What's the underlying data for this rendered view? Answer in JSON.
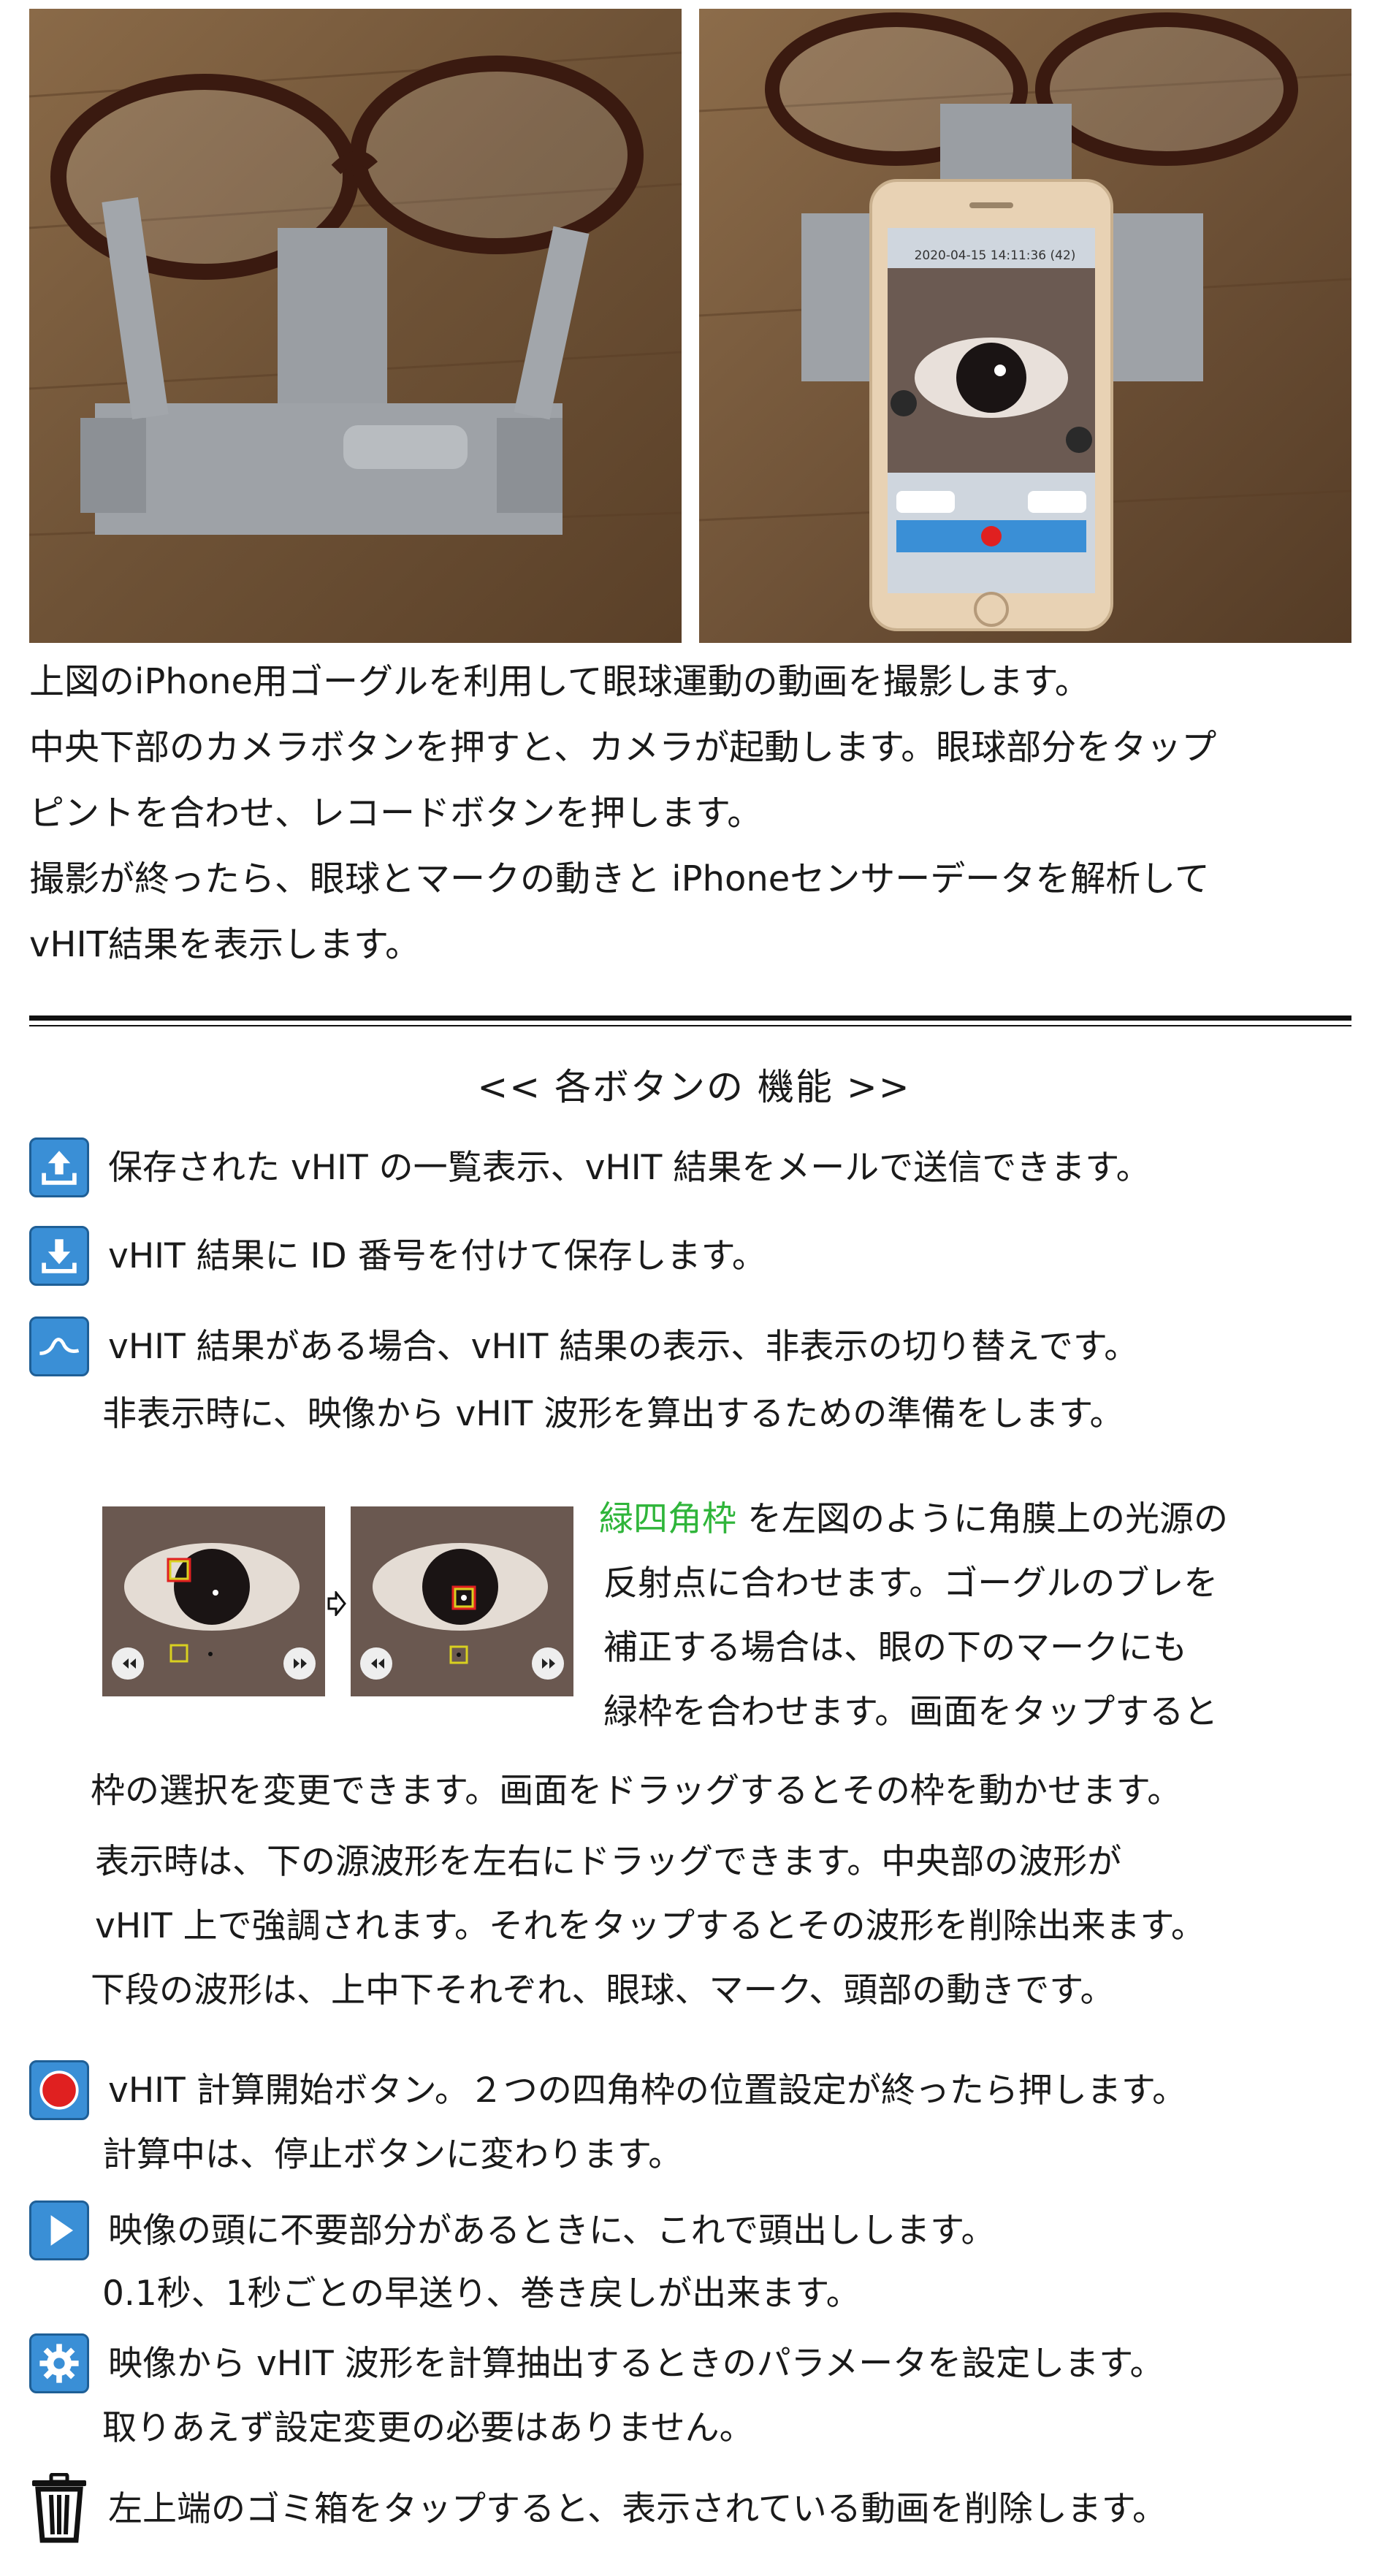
{
  "intro": {
    "lines": [
      "上図のiPhone用ゴーグルを利用して眼球運動の動画を撮影します。",
      " 中央下部のカメラボタンを押すと、カメラが起動します。眼球部分をタップ",
      "ピントを合わせ、レコードボタンを押します。",
      "撮影が終ったら、眼球とマークの動きと iPhoneセンサーデータを解析して",
      "vHIT結果を表示します。"
    ]
  },
  "phone_screen": {
    "timestamp": "2020-04-15 14:11:36 (42)"
  },
  "heading": "<< 各ボタンの 機能 >>",
  "buttons": {
    "list": {
      "icon": "upload-icon",
      "text": "保存された vHIT の一覧表示、vHIT 結果をメールで送信できます。"
    },
    "save": {
      "icon": "download-icon",
      "text": "vHIT 結果に ID 番号を付けて保存します。"
    },
    "wave": {
      "icon": "wave-icon",
      "text": "vHIT 結果がある場合、vHIT 結果の表示、非表示の切り替えです。",
      "sub": "非表示時に、映像から vHIT 波形を算出するための準備をします。"
    },
    "record": {
      "icon": "record-icon",
      "text": "vHIT 計算開始ボタン。２つの四角枠の位置設定が終ったら押します。",
      "sub": "計算中は、停止ボタンに変わります。"
    },
    "play": {
      "icon": "play-icon",
      "text": "映像の頭に不要部分があるときに、これで頭出しします。",
      "sub": "0.1秒、1秒ごとの早送り、巻き戻しが出来ます。"
    },
    "settings": {
      "icon": "gear-icon",
      "text": "映像から vHIT 波形を計算抽出するときのパラメータを設定します。",
      "sub": "取りあえず設定変更の必要はありません。"
    },
    "trash": {
      "icon": "trash-icon",
      "text": "左上端のゴミ箱をタップすると、表示されている動画を削除します。"
    }
  },
  "frame_desc": {
    "green_label": "緑四角枠",
    "line1_rest": " を左図のように角膜上の光源の",
    "line2": "反射点に合わせます。ゴーグルのブレを",
    "line3": "補正する場合は、眼の下のマークにも",
    "line4": "緑枠を合わせます。画面をタップすると",
    "line5": "枠の選択を変更できます。画面をドラッグするとその枠を動かせます。"
  },
  "display_desc": {
    "line1": "表示時は、下の源波形を左右にドラッグできます。中央部の波形が",
    "line2": "vHIT 上で強調されます。それをタップするとその波形を削除出来ます。",
    "line3": "下段の波形は、上中下それぞれ、眼球、マーク、頭部の動きです。"
  },
  "colors": {
    "icon_blue": "#3a8fd6",
    "green_text": "#2fb53a",
    "record_red": "#e02020"
  }
}
